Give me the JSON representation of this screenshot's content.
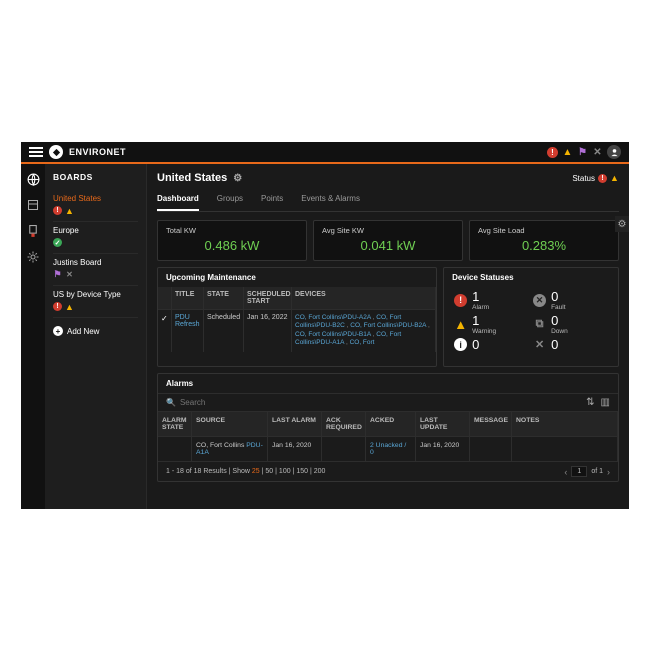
{
  "brand": "ENVIRONET",
  "topbar_icons": [
    "alert",
    "warning",
    "flag",
    "tools",
    "user"
  ],
  "sidebar": {
    "title": "BOARDS",
    "items": [
      {
        "label": "United States",
        "active": true,
        "icons": [
          "bang",
          "warn"
        ]
      },
      {
        "label": "Europe",
        "active": false,
        "icons": [
          "ok"
        ]
      },
      {
        "label": "Justins Board",
        "active": false,
        "icons": [
          "pur",
          "wrench"
        ]
      },
      {
        "label": "US by Device Type",
        "active": false,
        "icons": [
          "bang",
          "warn"
        ]
      }
    ],
    "add_label": "Add New"
  },
  "main": {
    "title": "United States",
    "status_label": "Status",
    "tabs": [
      {
        "label": "Dashboard",
        "active": true
      },
      {
        "label": "Groups",
        "active": false
      },
      {
        "label": "Points",
        "active": false
      },
      {
        "label": "Events & Alarms",
        "active": false
      }
    ],
    "kpis": [
      {
        "label": "Total KW",
        "value": "0.486 kW"
      },
      {
        "label": "Avg Site KW",
        "value": "0.041 kW"
      },
      {
        "label": "Avg Site Load",
        "value": "0.283%"
      }
    ],
    "upcoming": {
      "title": "Upcoming Maintenance",
      "columns": [
        "",
        "TITLE",
        "STATE",
        "SCHEDULED START",
        "DEVICES"
      ],
      "rows": [
        {
          "checked": true,
          "title": "PDU Refresh",
          "state": "Scheduled",
          "scheduled": "Jan 16, 2022",
          "devices": [
            "CO, Fort Collins\\PDU-A2A",
            "CO, Fort Collins\\PDU-B2C",
            "CO, Fort Collins\\PDU-B2A",
            "CO, Fort Collins\\PDU-B1A",
            "CO, Fort Collins\\PDU-A1A",
            "CO, Fort"
          ]
        }
      ]
    },
    "device_statuses": {
      "title": "Device Statuses",
      "items": [
        {
          "kind": "alarm",
          "label": "Alarm",
          "count": 1
        },
        {
          "kind": "fault",
          "label": "Fault",
          "count": 0
        },
        {
          "kind": "warn",
          "label": "Warning",
          "count": 1
        },
        {
          "kind": "down",
          "label": "Down",
          "count": 0
        },
        {
          "kind": "info",
          "label": "",
          "count": 0
        },
        {
          "kind": "wrench",
          "label": "",
          "count": 0
        }
      ]
    },
    "alarms": {
      "title": "Alarms",
      "search_placeholder": "Search",
      "columns": [
        "ALARM STATE",
        "SOURCE",
        "LAST ALARM",
        "ACK REQUIRED",
        "ACKED",
        "LAST UPDATE",
        "MESSAGE",
        "NOTES"
      ],
      "rows": [
        {
          "state": "",
          "source_text": "CO, Fort Collins ",
          "source_link": "PDU-A1A",
          "last_alarm": "Jan 16, 2020",
          "ack_required": "",
          "acked": "2 Unacked / 0",
          "last_update": "Jan 16, 2020",
          "message": "",
          "notes": ""
        }
      ],
      "footer": {
        "range": "1 - 18 of 18 Results",
        "show_label": "Show",
        "page_sizes": [
          "25",
          "50",
          "100",
          "150",
          "200"
        ],
        "current_size": "25",
        "page": "1",
        "of_label": "of 1"
      }
    }
  }
}
